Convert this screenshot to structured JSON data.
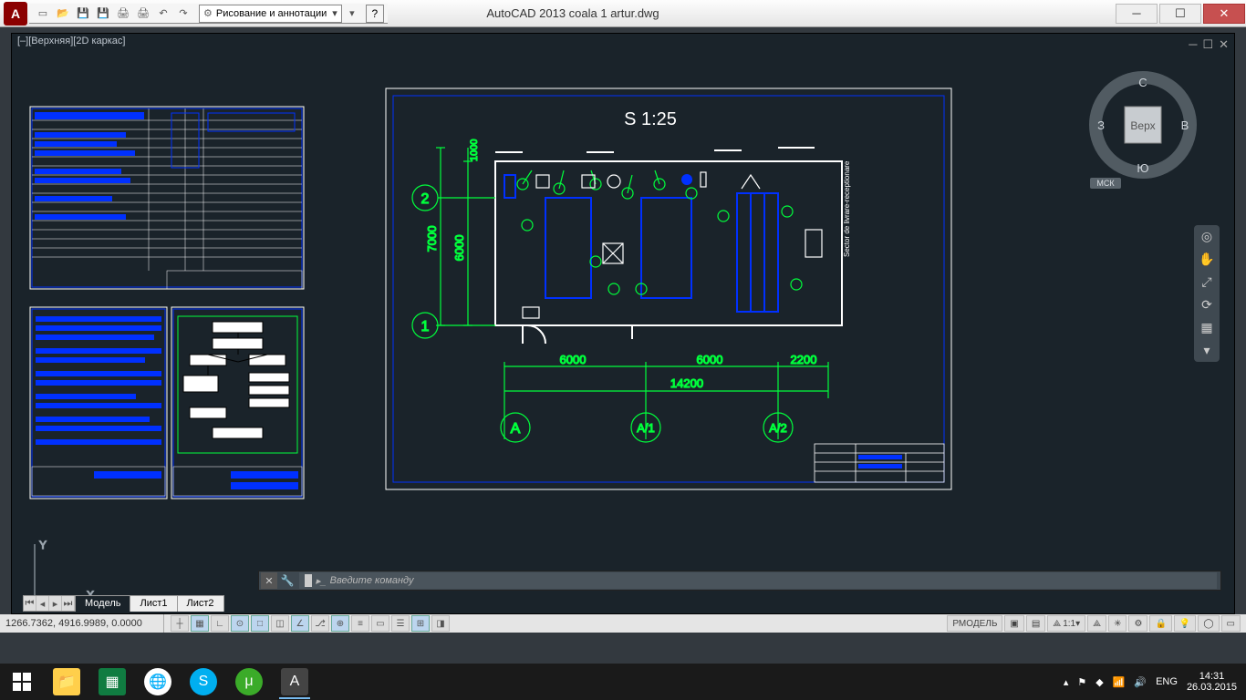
{
  "window": {
    "app_title": "AutoCAD 2013     coala 1 artur.dwg",
    "workspace": "Рисование и аннотации"
  },
  "viewport": {
    "label": "[–][Верхняя][2D каркас]"
  },
  "viewcube": {
    "top": "С",
    "right": "В",
    "bottom": "Ю",
    "left": "З",
    "face": "Верх",
    "cs": "МСК"
  },
  "drawing": {
    "scale": "S 1:25",
    "dims": {
      "h_left": "6000",
      "h_right": "6000",
      "h_far": "2200",
      "h_total": "14200",
      "v_inner": "6000",
      "v_outer": "7000",
      "v_top": "1000"
    },
    "axes": {
      "row2": "2",
      "row1": "1",
      "colA": "A",
      "colA1": "A/1",
      "colA2": "A/2"
    },
    "side_label": "Sector de livrare-receptionare"
  },
  "command": {
    "placeholder": "Введите команду"
  },
  "coords": "1266.7362, 4916.9989, 0.0000",
  "tabs": {
    "model": "Модель",
    "sheet1": "Лист1",
    "sheet2": "Лист2"
  },
  "status_right": {
    "model": "РМОДЕЛЬ",
    "anno": "1:1",
    "lang": "ENG"
  },
  "taskbar": {
    "time": "14:31",
    "date": "26.03.2015",
    "lang": "ENG"
  }
}
